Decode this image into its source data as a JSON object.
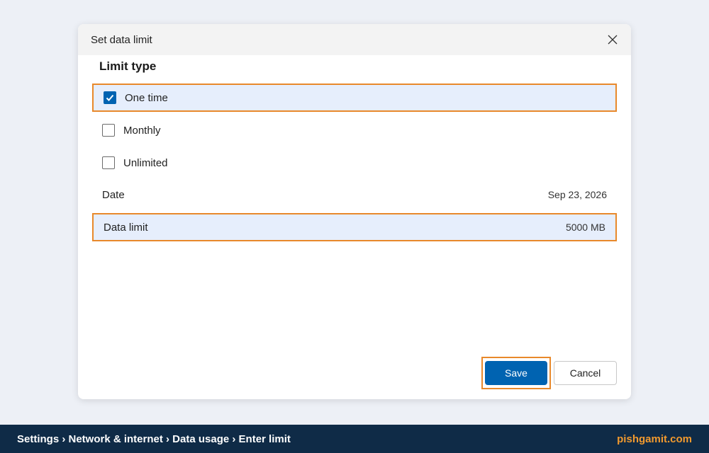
{
  "dialog": {
    "title": "Set data limit",
    "section_heading": "Limit type",
    "options": [
      {
        "label": "One time",
        "checked": true
      },
      {
        "label": "Monthly",
        "checked": false
      },
      {
        "label": "Unlimited",
        "checked": false
      }
    ],
    "fields": {
      "date": {
        "label": "Date",
        "value": "Sep 23, 2026"
      },
      "data_limit": {
        "label": "Data limit",
        "value": "5000 MB"
      }
    },
    "buttons": {
      "save": "Save",
      "cancel": "Cancel"
    },
    "icons": {
      "close": "close-icon",
      "check": "checkmark-icon"
    }
  },
  "footer": {
    "breadcrumb": "Settings › Network & internet › Data usage › Enter limit",
    "site": "pishgamit.com"
  },
  "colors": {
    "accent": "#0063b1",
    "highlight_border": "#e8892b",
    "footer_bg": "#0f2b47",
    "site_text": "#f29a2e"
  }
}
